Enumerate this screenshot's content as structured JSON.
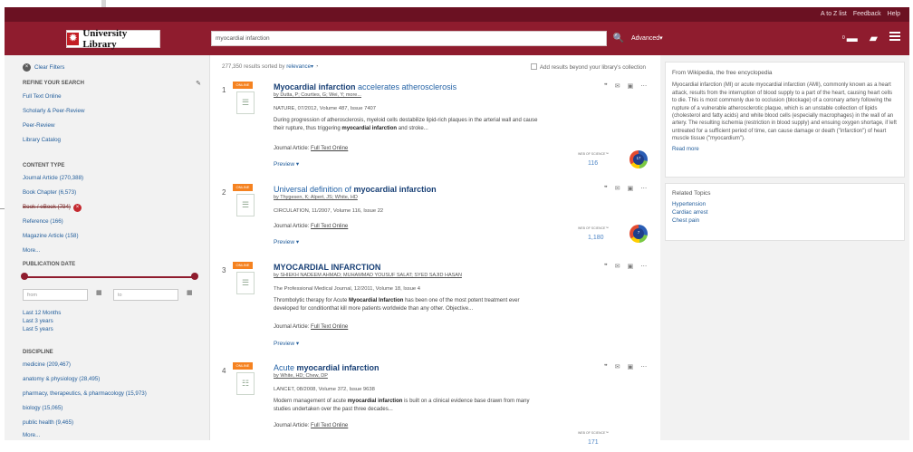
{
  "top_links": [
    "A to Z list",
    "Feedback",
    "Help"
  ],
  "logo_text": "University Library",
  "search": {
    "value": "myocardial infarction",
    "advanced": "Advanced▾"
  },
  "header": {
    "badge": "0"
  },
  "sidebar": {
    "clear_filters": "Clear Filters",
    "refine": "REFINE YOUR SEARCH",
    "refine_items": [
      "Full Text Online",
      "Scholarly & Peer-Review",
      "Peer-Review",
      "Library Catalog"
    ],
    "content_type": "CONTENT TYPE",
    "content_items": [
      "Journal Article (270,388)",
      "Book Chapter (6,573)",
      "Book / eBook (794)",
      "Reference (166)",
      "Magazine Article (158)",
      "More..."
    ],
    "publication_date": "PUBLICATION DATE",
    "from": "from",
    "to": "to",
    "date_links": [
      "Last 12 Months",
      "Last 3 years",
      "Last 5 years"
    ],
    "discipline": "DISCIPLINE",
    "discipline_items": [
      "medicine (209,467)",
      "anatomy & physiology (28,495)",
      "pharmacy, therapeutics, & pharmacology (15,973)",
      "biology (15,065)",
      "public health (9,465)",
      "More..."
    ]
  },
  "results": {
    "summary_prefix": "277,350 results sorted by",
    "summary_sort": "relevance▾",
    "add_beyond": "Add results beyond your library's collection",
    "items": [
      {
        "number": "1",
        "tag": "ONLINE",
        "title_strong": "Myocardial infarction",
        "title_rest": " accelerates atherosclerosis",
        "authors": "by Dutta, P; Courties, G; Wei, Y; more...",
        "source": "NATURE, 07/2012, Volume 487, Issue 7407",
        "snippet": "During progression of atherosclerosis, myeloid cells destabilize lipid-rich plaques in the arterial wall and cause their rupture, thus triggering myocardial infarction and stroke...",
        "snippet_bold": "myocardial infarction",
        "journal_type": "Journal Article:",
        "full_text": "Full Text Online",
        "preview": "Preview ▾",
        "wos_label": "WEB OF SCIENCE™",
        "citations": "116",
        "ring": "17"
      },
      {
        "number": "2",
        "tag": "ONLINE",
        "title_prefix": "Universal definition of ",
        "title_strong": "myocardial infarction",
        "authors": "by Thygesen, K; Alpert, JS; White, HD",
        "source": "CIRCULATION, 11/2007, Volume 116, Issue 22",
        "journal_type": "Journal Article:",
        "full_text": "Full Text Online",
        "preview": "Preview ▾",
        "wos_label": "WEB OF SCIENCE™",
        "citations": "1,180",
        "ring": "7"
      },
      {
        "number": "3",
        "tag": "ONLINE",
        "title_strong": "MYOCARDIAL INFARCTION",
        "authors": "by SHIEKH NADEEM AHMAD; MUHAMMAD YOUSUF SALAT; SYED SAJID HASAN",
        "source": "The Professional Medical Journal, 12/2011, Volume 18, Issue 4",
        "snippet": "Thrombolytic therapy for Acute Myocardial Infarction has been one of the most potent treatment ever developed for conditionthat kill more patients worldwide than any other. Objective...",
        "snippet_bold": "Myocardial Infarction",
        "journal_type": "Journal Article:",
        "full_text": "Full Text Online",
        "preview": "Preview ▾"
      },
      {
        "number": "4",
        "tag": "ONLINE",
        "title_prefix": "Acute ",
        "title_strong": "myocardial infarction",
        "authors": "by White, HD; Chew, DP",
        "source": "LANCET, 08/2008, Volume 372, Issue 9638",
        "snippet": "Modern management of acute myocardial infarction is built on a clinical evidence base drawn from many studies undertaken over the past three decades...",
        "snippet_bold": "myocardial infarction",
        "journal_type": "Journal Article:",
        "full_text": "Full Text Online",
        "wos_label": "WEB OF SCIENCE™",
        "citations": "171"
      }
    ]
  },
  "wikipedia": {
    "heading": "From Wikipedia, the free encyclopedia",
    "text": "Myocardial infarction (MI) or acute myocardial infarction (AMI), commonly known as a heart attack, results from the interruption of blood supply to a part of the heart, causing heart cells to die. This is most commonly due to occlusion (blockage) of a coronary artery following the rupture of a vulnerable atherosclerotic plaque, which is an unstable collection of lipids (cholesterol and fatty acids) and white blood cells (especially macrophages) in the wall of an artery. The resulting ischemia (restriction in blood supply) and ensuing oxygen shortage, if left untreated for a sufficient period of time, can cause damage or death (\"infarction\") of heart muscle tissue (\"myocardium\").",
    "read_more": "Read more"
  },
  "related": {
    "heading": "Related Topics",
    "items": [
      "Hypertension",
      "Cardiac arrest",
      "Chest pain"
    ]
  }
}
